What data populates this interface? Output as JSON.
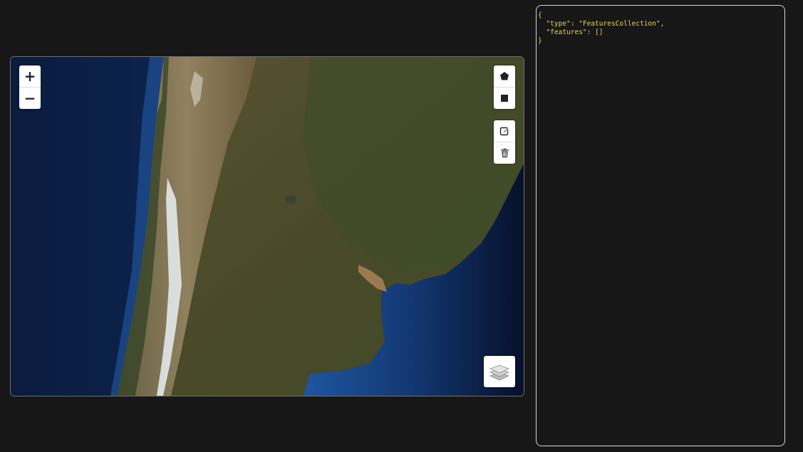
{
  "map": {
    "zoom_in_label": "+",
    "zoom_out_label": "−",
    "draw_tools": [
      "polygon-icon",
      "rectangle-icon"
    ],
    "edit_tools": [
      "edit-icon",
      "trash-icon"
    ],
    "layers_control_icon": "layers-icon",
    "colors": {
      "ocean_deep": "#0a1c3f",
      "ocean_shelf": "#1c4f96",
      "land": "#4b4a2c",
      "andes": "#8b7a5a",
      "snow": "#e8eef2"
    }
  },
  "geojson_panel": {
    "text": "{\n  \"type\": \"FeaturesCollection\",\n  \"features\": []\n}",
    "text_color": "#e6d64a"
  }
}
